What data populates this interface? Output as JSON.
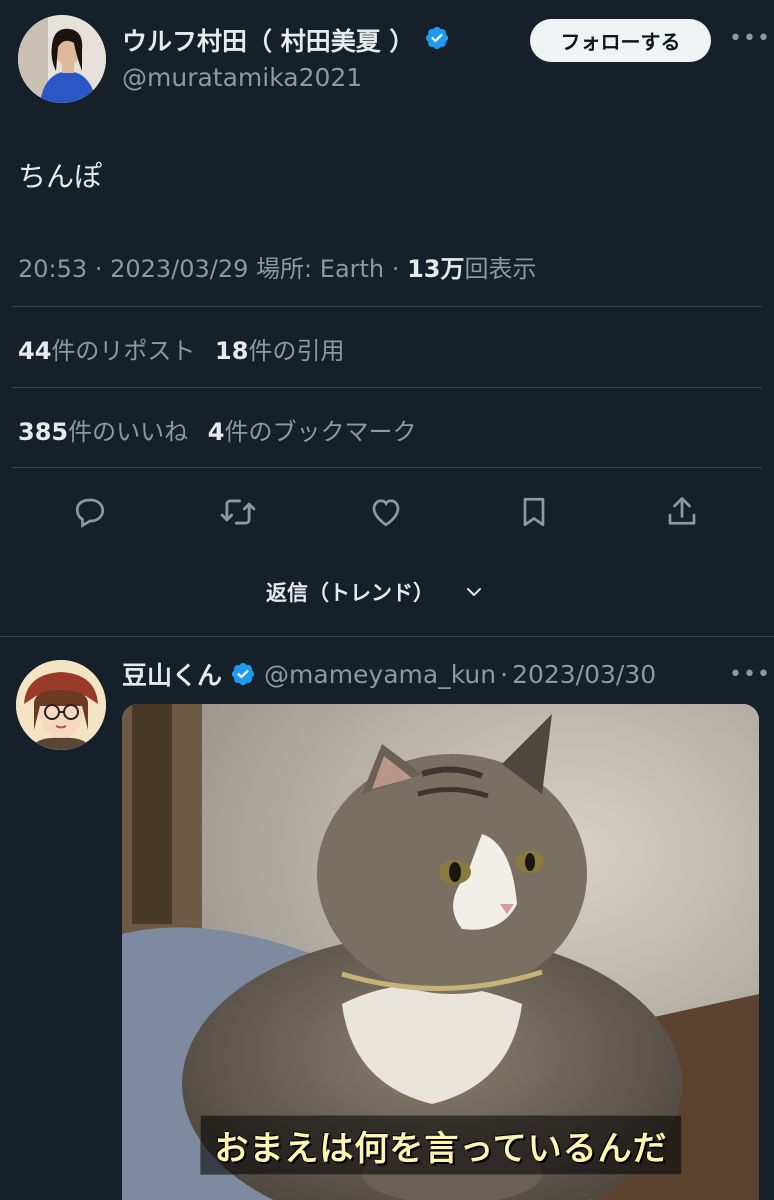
{
  "tweet": {
    "author_name": "ウルフ村田（ 村田美夏 ）",
    "author_handle": "@muratamika2021",
    "follow_label": "フォローする",
    "text": "ちんぽ",
    "meta": {
      "time": "20:53",
      "sep1": "·",
      "date": "2023/03/29",
      "location": "場所: Earth",
      "sep2": "·",
      "views_count": "13万",
      "views_label": "回表示"
    },
    "stats": {
      "reposts_count": "44",
      "reposts_label": "件のリポスト",
      "quotes_count": "18",
      "quotes_label": "件の引用",
      "likes_count": "385",
      "likes_label": "件のいいね",
      "bookmarks_count": "4",
      "bookmarks_label": "件のブックマーク"
    },
    "actions": [
      "reply-icon",
      "retweet-icon",
      "like-icon",
      "bookmark-icon",
      "share-icon"
    ]
  },
  "replies_sort": {
    "label": "返信（トレンド）"
  },
  "reply": {
    "author_name": "豆山くん",
    "author_handle": "@mameyama_kun",
    "sep": "·",
    "date": "2023/03/30",
    "image_caption": "おまえは何を言っているんだ"
  },
  "colors": {
    "background": "#15202b",
    "text": "#e7e9ea",
    "muted": "#8b98a5",
    "verified": "#1d9bf0",
    "divider": "#38444d"
  }
}
